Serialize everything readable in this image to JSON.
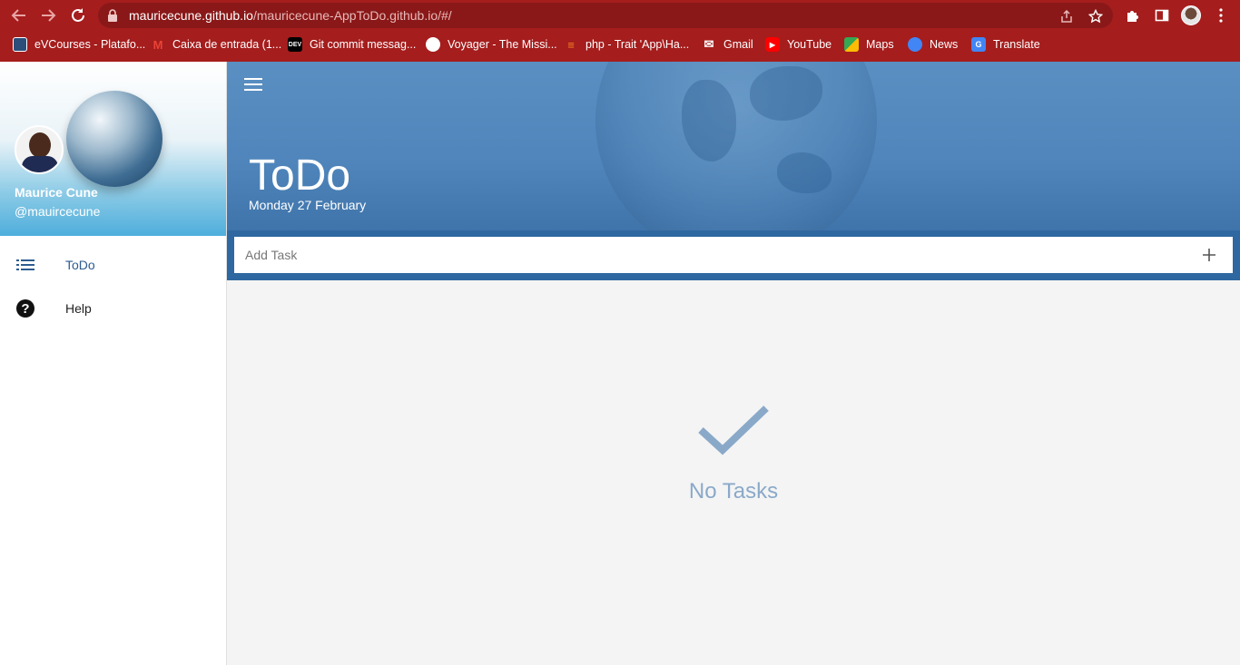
{
  "browser": {
    "url_host": "mauricecune.github.io",
    "url_path": "/mauricecune-AppToDo.github.io/#/",
    "bookmarks": [
      {
        "label": "eVCourses - Platafo...",
        "icon": "evcourses-favicon"
      },
      {
        "label": "Caixa de entrada (1...",
        "icon": "gmail-favicon"
      },
      {
        "label": "Git commit messag...",
        "icon": "dev-favicon"
      },
      {
        "label": "Voyager - The Missi...",
        "icon": "voyager-favicon"
      },
      {
        "label": "php - Trait 'App\\Ha...",
        "icon": "stackoverflow-favicon"
      },
      {
        "label": "Gmail",
        "icon": "gmail-favicon"
      },
      {
        "label": "YouTube",
        "icon": "youtube-favicon"
      },
      {
        "label": "Maps",
        "icon": "maps-favicon"
      },
      {
        "label": "News",
        "icon": "news-favicon"
      },
      {
        "label": "Translate",
        "icon": "translate-favicon"
      }
    ],
    "colors": {
      "frame": "#a51d1d",
      "omnibox": "#8a1818"
    }
  },
  "sidebar": {
    "user": {
      "name": "Maurice Cune",
      "handle": "@mauircecune"
    },
    "items": [
      {
        "label": "ToDo",
        "icon": "list-icon",
        "active": true
      },
      {
        "label": "Help",
        "icon": "help-icon",
        "active": false
      }
    ]
  },
  "header": {
    "title": "ToDo",
    "date": "Monday 27 February"
  },
  "task_input": {
    "placeholder": "Add Task",
    "value": ""
  },
  "empty_state": {
    "message": "No Tasks",
    "icon": "check-icon"
  },
  "colors": {
    "accent": "#2f67a0",
    "hero": "#4f85bb",
    "empty_text": "#8aa9c9"
  }
}
